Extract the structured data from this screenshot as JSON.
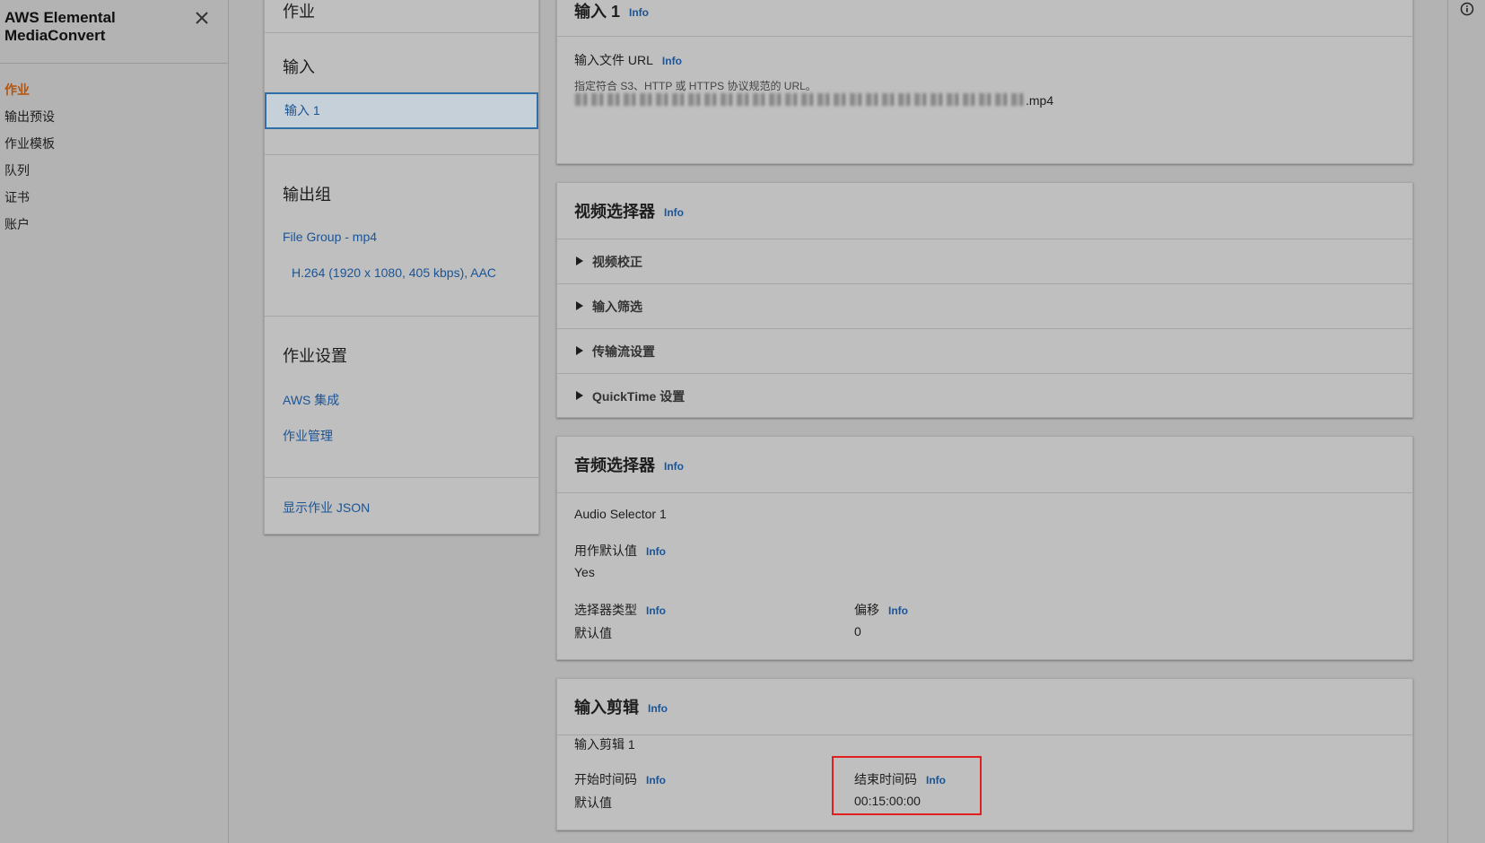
{
  "sidenav": {
    "brand": "AWS Elemental MediaConvert",
    "items": [
      {
        "label": "作业",
        "active": true
      },
      {
        "label": "输出预设"
      },
      {
        "label": "作业模板"
      },
      {
        "label": "队列"
      },
      {
        "label": "证书"
      },
      {
        "label": "账户"
      }
    ]
  },
  "steps": {
    "title": "作业",
    "input_section": "输入",
    "input_1": "输入 1",
    "output_section": "输出组",
    "file_group": "File Group - mp4",
    "output_item": "H.264 (1920 x 1080, 405 kbps), AAC",
    "job_settings_section": "作业设置",
    "aws_integration": "AWS 集成",
    "job_management": "作业管理",
    "show_json": "显示作业 JSON"
  },
  "info_label": "Info",
  "input_card": {
    "title": "输入 1",
    "url_label": "输入文件 URL",
    "url_hint": "指定符合 S3、HTTP 或 HTTPS 协议规范的 URL。",
    "url_suffix": ".mp4"
  },
  "video_card": {
    "title": "视频选择器",
    "expanders": [
      "视频校正",
      "输入筛选",
      "传输流设置",
      "QuickTime 设置"
    ]
  },
  "audio_card": {
    "title": "音频选择器",
    "selector_name": "Audio Selector 1",
    "default_label": "用作默认值",
    "default_value": "Yes",
    "type_label": "选择器类型",
    "type_value": "默认值",
    "offset_label": "偏移",
    "offset_value": "0"
  },
  "clip_card": {
    "title": "输入剪辑",
    "clip_name": "输入剪辑 1",
    "start_label": "开始时间码",
    "start_value": "默认值",
    "end_label": "结束时间码",
    "end_value": "00:15:00:00"
  },
  "colors": {
    "accent_active": "#b3540e",
    "link": "#1b5494",
    "highlight": "#e02020"
  }
}
